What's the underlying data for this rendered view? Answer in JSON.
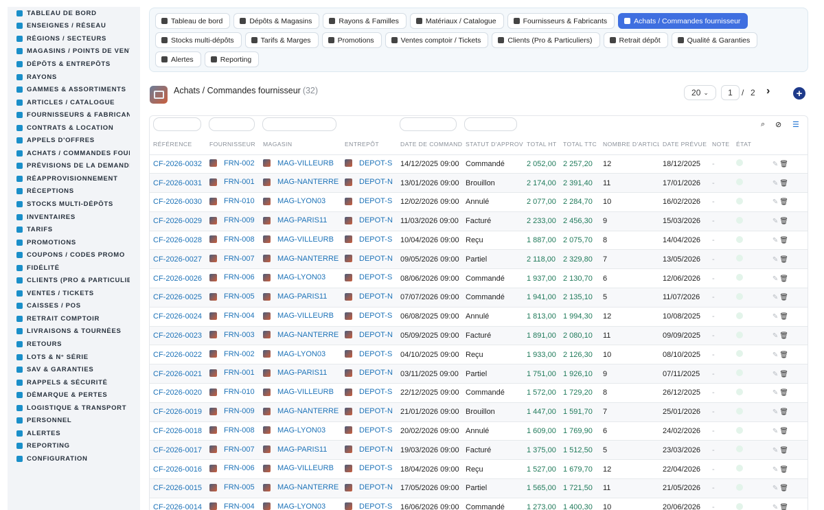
{
  "sidebar": {
    "items": [
      {
        "label": "Tableau de bord",
        "icon": "dashboard-icon"
      },
      {
        "label": "Enseignes / Réseau",
        "icon": "flag-icon"
      },
      {
        "label": "Régions / Secteurs",
        "icon": "map-icon"
      },
      {
        "label": "Magasins / Points de vente",
        "icon": "store-icon"
      },
      {
        "label": "Dépôts & Entrepôts",
        "icon": "warehouse-icon"
      },
      {
        "label": "Rayons",
        "icon": "shelf-icon"
      },
      {
        "label": "Gammes & Assortiments",
        "icon": "layers-icon"
      },
      {
        "label": "Articles / Catalogue",
        "icon": "catalog-icon"
      },
      {
        "label": "Fournisseurs & Fabricants",
        "icon": "truck-icon"
      },
      {
        "label": "Contrats & Location",
        "icon": "contract-icon"
      },
      {
        "label": "Appels d'offres",
        "icon": "gavel-icon"
      },
      {
        "label": "Achats / Commandes fournisseur",
        "icon": "cart-icon"
      },
      {
        "label": "Prévisions de la demande",
        "icon": "chart-icon"
      },
      {
        "label": "Réapprovisionnement",
        "icon": "refresh-icon"
      },
      {
        "label": "Réceptions",
        "icon": "inbox-icon"
      },
      {
        "label": "Stocks multi-dépôts",
        "icon": "boxes-icon"
      },
      {
        "label": "Inventaires",
        "icon": "clipboard-icon"
      },
      {
        "label": "Tarifs",
        "icon": "tag-icon"
      },
      {
        "label": "Promotions",
        "icon": "percent-icon"
      },
      {
        "label": "Coupons / Codes promo",
        "icon": "ticket-icon"
      },
      {
        "label": "Fidélité",
        "icon": "star-icon"
      },
      {
        "label": "Clients (Pro & Particuliers)",
        "icon": "user-icon"
      },
      {
        "label": "Ventes / Tickets",
        "icon": "receipt-icon"
      },
      {
        "label": "Caisses / POS",
        "icon": "cash-register-icon"
      },
      {
        "label": "Retrait comptoir",
        "icon": "counter-icon"
      },
      {
        "label": "Livraisons & Tournées",
        "icon": "delivery-icon"
      },
      {
        "label": "Retours",
        "icon": "undo-icon"
      },
      {
        "label": "Lots & N° série",
        "icon": "barcode-icon"
      },
      {
        "label": "SAV & Garanties",
        "icon": "tools-icon"
      },
      {
        "label": "Rappels & Sécurité",
        "icon": "warning-icon"
      },
      {
        "label": "Démarque & Pertes",
        "icon": "trash-icon"
      },
      {
        "label": "Logistique & Transport",
        "icon": "logistics-icon"
      },
      {
        "label": "Personnel",
        "icon": "users-icon"
      },
      {
        "label": "Alertes",
        "icon": "bell-icon"
      },
      {
        "label": "Reporting",
        "icon": "report-icon"
      },
      {
        "label": "Configuration",
        "icon": "gear-icon"
      }
    ]
  },
  "tabs": [
    {
      "label": "Tableau de bord",
      "icon": "dashboard-icon",
      "active": false
    },
    {
      "label": "Dépôts & Magasins",
      "icon": "warehouse-icon",
      "active": false
    },
    {
      "label": "Rayons & Familles",
      "icon": "shelf-icon",
      "active": false
    },
    {
      "label": "Matériaux / Catalogue",
      "icon": "catalog-icon",
      "active": false
    },
    {
      "label": "Fournisseurs & Fabricants",
      "icon": "truck-icon",
      "active": false
    },
    {
      "label": "Achats / Commandes fournisseur",
      "icon": "cart-icon",
      "active": true
    },
    {
      "label": "Stocks multi-dépôts",
      "icon": "boxes-icon",
      "active": false
    },
    {
      "label": "Tarifs & Marges",
      "icon": "tag-icon",
      "active": false
    },
    {
      "label": "Promotions",
      "icon": "percent-icon",
      "active": false
    },
    {
      "label": "Ventes comptoir / Tickets",
      "icon": "receipt-icon",
      "active": false
    },
    {
      "label": "Clients (Pro & Particuliers)",
      "icon": "user-icon",
      "active": false
    },
    {
      "label": "Retrait dépôt",
      "icon": "car-icon",
      "active": false
    },
    {
      "label": "Qualité & Garanties",
      "icon": "check-icon",
      "active": false
    },
    {
      "label": "Alertes",
      "icon": "bell-icon",
      "active": false
    },
    {
      "label": "Reporting",
      "icon": "report-icon",
      "active": false
    }
  ],
  "header": {
    "title": "Achats / Commandes fournisseur",
    "count": "(32)",
    "page_size": "20",
    "page": "1",
    "page_sep": "/",
    "page_total": "2"
  },
  "table": {
    "columns": [
      "Référence",
      "Fournisseur",
      "Magasin",
      "Entrepôt",
      "Date de commande",
      "Statut d'approvisionnement",
      "Total HT",
      "Total TTC",
      "Nombre d'articles",
      "Date prévue",
      "Note",
      "État"
    ],
    "rows": [
      [
        "CF-2026-0032",
        "FRN-002",
        "MAG-VILLEURB",
        "DEPOT-S",
        "14/12/2025 09:00",
        "Commandé",
        "2 052,00",
        "2 257,20",
        "12",
        "18/12/2025",
        "-"
      ],
      [
        "CF-2026-0031",
        "FRN-001",
        "MAG-NANTERRE",
        "DEPOT-N",
        "13/01/2026 09:00",
        "Brouillon",
        "2 174,00",
        "2 391,40",
        "11",
        "17/01/2026",
        "-"
      ],
      [
        "CF-2026-0030",
        "FRN-010",
        "MAG-LYON03",
        "DEPOT-S",
        "12/02/2026 09:00",
        "Annulé",
        "2 077,00",
        "2 284,70",
        "10",
        "16/02/2026",
        "-"
      ],
      [
        "CF-2026-0029",
        "FRN-009",
        "MAG-PARIS11",
        "DEPOT-N",
        "11/03/2026 09:00",
        "Facturé",
        "2 233,00",
        "2 456,30",
        "9",
        "15/03/2026",
        "-"
      ],
      [
        "CF-2026-0028",
        "FRN-008",
        "MAG-VILLEURB",
        "DEPOT-S",
        "10/04/2026 09:00",
        "Reçu",
        "1 887,00",
        "2 075,70",
        "8",
        "14/04/2026",
        "-"
      ],
      [
        "CF-2026-0027",
        "FRN-007",
        "MAG-NANTERRE",
        "DEPOT-N",
        "09/05/2026 09:00",
        "Partiel",
        "2 118,00",
        "2 329,80",
        "7",
        "13/05/2026",
        "-"
      ],
      [
        "CF-2026-0026",
        "FRN-006",
        "MAG-LYON03",
        "DEPOT-S",
        "08/06/2026 09:00",
        "Commandé",
        "1 937,00",
        "2 130,70",
        "6",
        "12/06/2026",
        "-"
      ],
      [
        "CF-2026-0025",
        "FRN-005",
        "MAG-PARIS11",
        "DEPOT-N",
        "07/07/2026 09:00",
        "Commandé",
        "1 941,00",
        "2 135,10",
        "5",
        "11/07/2026",
        "-"
      ],
      [
        "CF-2026-0024",
        "FRN-004",
        "MAG-VILLEURB",
        "DEPOT-S",
        "06/08/2025 09:00",
        "Annulé",
        "1 813,00",
        "1 994,30",
        "12",
        "10/08/2025",
        "-"
      ],
      [
        "CF-2026-0023",
        "FRN-003",
        "MAG-NANTERRE",
        "DEPOT-N",
        "05/09/2025 09:00",
        "Facturé",
        "1 891,00",
        "2 080,10",
        "11",
        "09/09/2025",
        "-"
      ],
      [
        "CF-2026-0022",
        "FRN-002",
        "MAG-LYON03",
        "DEPOT-S",
        "04/10/2025 09:00",
        "Reçu",
        "1 933,00",
        "2 126,30",
        "10",
        "08/10/2025",
        "-"
      ],
      [
        "CF-2026-0021",
        "FRN-001",
        "MAG-PARIS11",
        "DEPOT-N",
        "03/11/2025 09:00",
        "Partiel",
        "1 751,00",
        "1 926,10",
        "9",
        "07/11/2025",
        "-"
      ],
      [
        "CF-2026-0020",
        "FRN-010",
        "MAG-VILLEURB",
        "DEPOT-S",
        "22/12/2025 09:00",
        "Commandé",
        "1 572,00",
        "1 729,20",
        "8",
        "26/12/2025",
        "-"
      ],
      [
        "CF-2026-0019",
        "FRN-009",
        "MAG-NANTERRE",
        "DEPOT-N",
        "21/01/2026 09:00",
        "Brouillon",
        "1 447,00",
        "1 591,70",
        "7",
        "25/01/2026",
        "-"
      ],
      [
        "CF-2026-0018",
        "FRN-008",
        "MAG-LYON03",
        "DEPOT-S",
        "20/02/2026 09:00",
        "Annulé",
        "1 609,00",
        "1 769,90",
        "6",
        "24/02/2026",
        "-"
      ],
      [
        "CF-2026-0017",
        "FRN-007",
        "MAG-PARIS11",
        "DEPOT-N",
        "19/03/2026 09:00",
        "Facturé",
        "1 375,00",
        "1 512,50",
        "5",
        "23/03/2026",
        "-"
      ],
      [
        "CF-2026-0016",
        "FRN-006",
        "MAG-VILLEURB",
        "DEPOT-S",
        "18/04/2026 09:00",
        "Reçu",
        "1 527,00",
        "1 679,70",
        "12",
        "22/04/2026",
        "-"
      ],
      [
        "CF-2026-0015",
        "FRN-005",
        "MAG-NANTERRE",
        "DEPOT-N",
        "17/05/2026 09:00",
        "Partiel",
        "1 565,00",
        "1 721,50",
        "11",
        "21/05/2026",
        "-"
      ],
      [
        "CF-2026-0014",
        "FRN-004",
        "MAG-LYON03",
        "DEPOT-S",
        "16/06/2026 09:00",
        "Commandé",
        "1 273,00",
        "1 400,30",
        "10",
        "20/06/2026",
        "-"
      ]
    ]
  },
  "colors": {
    "accent": "#3f6fe0",
    "link": "#1e73b8",
    "amount": "#1f7a5a",
    "sidebar_icon": "#1a8fc9"
  }
}
